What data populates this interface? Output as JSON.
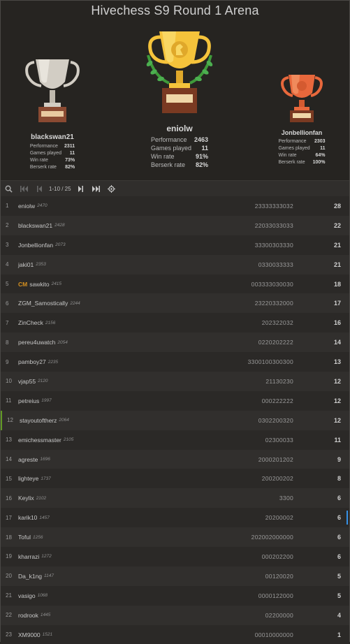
{
  "header": {
    "title": "Hivechess S9 Round 1 Arena"
  },
  "podium": {
    "first": {
      "name": "eniolw",
      "performance_label": "Performance",
      "performance": "2463",
      "games_label": "Games played",
      "games": "11",
      "winrate_label": "Win rate",
      "winrate": "91%",
      "berserk_label": "Berserk rate",
      "berserk": "82%"
    },
    "second": {
      "name": "blackswan21",
      "performance_label": "Performance",
      "performance": "2311",
      "games_label": "Games played",
      "games": "11",
      "winrate_label": "Win rate",
      "winrate": "73%",
      "berserk_label": "Berserk rate",
      "berserk": "82%"
    },
    "third": {
      "name": "Jonbellionfan",
      "performance_label": "Performance",
      "performance": "2303",
      "games_label": "Games played",
      "games": "11",
      "winrate_label": "Win rate",
      "winrate": "64%",
      "berserk_label": "Berserk rate",
      "berserk": "100%"
    }
  },
  "pager": {
    "page_label": "1-10 / 25",
    "icons": [
      "search-icon",
      "first-page-icon",
      "prev-page-icon",
      "next-page-icon",
      "last-page-icon",
      "locate-me-icon"
    ]
  },
  "colors": {
    "gold": "#f5c33b",
    "silver": "#d2cdc4",
    "bronze": "#e8683c",
    "title_badge": "#d59020"
  },
  "standings": [
    {
      "rank": "1",
      "title": "",
      "name": "eniolw",
      "rating": "2470",
      "sheet": "23333333032",
      "score": "28"
    },
    {
      "rank": "2",
      "title": "",
      "name": "blackswan21",
      "rating": "2428",
      "sheet": "22033033033",
      "score": "22"
    },
    {
      "rank": "3",
      "title": "",
      "name": "Jonbellionfan",
      "rating": "2073",
      "sheet": "33300303330",
      "score": "21"
    },
    {
      "rank": "4",
      "title": "",
      "name": "jaki01",
      "rating": "2353",
      "sheet": "0330033333",
      "score": "21"
    },
    {
      "rank": "5",
      "title": "CM",
      "name": "sawkito",
      "rating": "2415",
      "sheet": "003333030030",
      "score": "18"
    },
    {
      "rank": "6",
      "title": "",
      "name": "ZGM_Samostically",
      "rating": "2244",
      "sheet": "23220332000",
      "score": "17"
    },
    {
      "rank": "7",
      "title": "",
      "name": "ZinCheck",
      "rating": "2156",
      "sheet": "202322032",
      "score": "16"
    },
    {
      "rank": "8",
      "title": "",
      "name": "pereu4uwatch",
      "rating": "2054",
      "sheet": "0220202222",
      "score": "14"
    },
    {
      "rank": "9",
      "title": "",
      "name": "pamboy27",
      "rating": "2235",
      "sheet": "3300100300300",
      "score": "13"
    },
    {
      "rank": "10",
      "title": "",
      "name": "vjap55",
      "rating": "2120",
      "sheet": "21130230",
      "score": "12"
    },
    {
      "rank": "11",
      "title": "",
      "name": "petreius",
      "rating": "1997",
      "sheet": "000222222",
      "score": "12"
    },
    {
      "rank": "12",
      "title": "",
      "name": "stayoutoftherz",
      "rating": "2064",
      "sheet": "0302200320",
      "score": "12"
    },
    {
      "rank": "13",
      "title": "",
      "name": "emichessmaster",
      "rating": "2105",
      "sheet": "02300033",
      "score": "11"
    },
    {
      "rank": "14",
      "title": "",
      "name": "agreste",
      "rating": "1696",
      "sheet": "2000201202",
      "score": "9"
    },
    {
      "rank": "15",
      "title": "",
      "name": "lighteye",
      "rating": "1737",
      "sheet": "200200202",
      "score": "8"
    },
    {
      "rank": "16",
      "title": "",
      "name": "Keylix",
      "rating": "2102",
      "sheet": "3300",
      "score": "6"
    },
    {
      "rank": "17",
      "title": "",
      "name": "karik10",
      "rating": "1457",
      "sheet": "20200002",
      "score": "6"
    },
    {
      "rank": "18",
      "title": "",
      "name": "Toful",
      "rating": "1256",
      "sheet": "202002000000",
      "score": "6"
    },
    {
      "rank": "19",
      "title": "",
      "name": "kharrazi",
      "rating": "1272",
      "sheet": "000202200",
      "score": "6"
    },
    {
      "rank": "20",
      "title": "",
      "name": "Da_k1ng",
      "rating": "1147",
      "sheet": "00120020",
      "score": "5"
    },
    {
      "rank": "21",
      "title": "",
      "name": "vasigo",
      "rating": "1068",
      "sheet": "0000122000",
      "score": "5"
    },
    {
      "rank": "22",
      "title": "",
      "name": "rodrook",
      "rating": "1445",
      "sheet": "02200000",
      "score": "4"
    },
    {
      "rank": "23",
      "title": "",
      "name": "XM9000",
      "rating": "1521",
      "sheet": "00010000000",
      "score": "1"
    }
  ]
}
